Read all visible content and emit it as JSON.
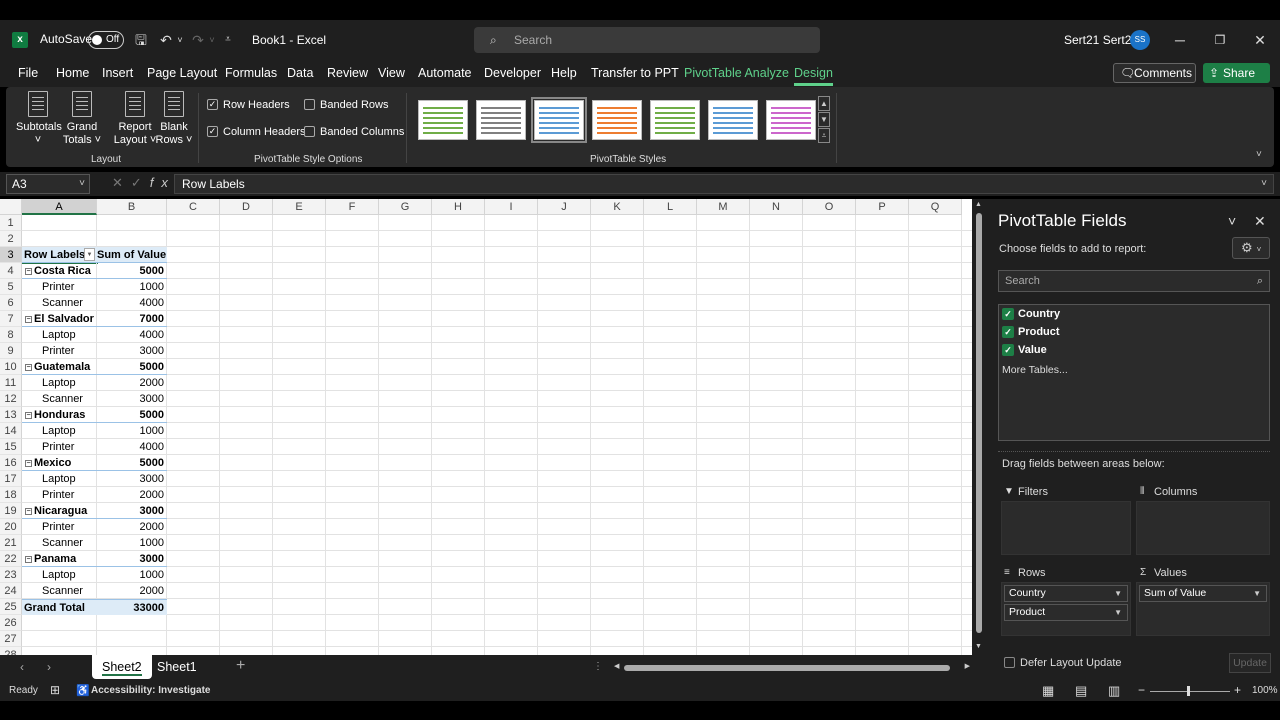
{
  "titlebar": {
    "autosave_label": "AutoSave",
    "autosave_state": "Off",
    "doc_title": "Book1 - Excel",
    "search_placeholder": "Search",
    "user_name": "Sert21 Sert21",
    "user_initials": "SS"
  },
  "menu": {
    "items": [
      "File",
      "Home",
      "Insert",
      "Page Layout",
      "Formulas",
      "Data",
      "Review",
      "View",
      "Automate",
      "Developer",
      "Help",
      "Transfer to PPT",
      "PivotTable Analyze",
      "Design"
    ],
    "comments_label": "Comments",
    "share_label": "Share"
  },
  "ribbon": {
    "layout_buttons": [
      {
        "line1": "Subtotals",
        "line2": "˅"
      },
      {
        "line1": "Grand",
        "line2": "Totals ˅"
      },
      {
        "line1": "Report",
        "line2": "Layout ˅"
      },
      {
        "line1": "Blank",
        "line2": "Rows ˅"
      }
    ],
    "layout_group": "Layout",
    "options": {
      "row_headers": "Row Headers",
      "column_headers": "Column Headers",
      "banded_rows": "Banded Rows",
      "banded_columns": "Banded Columns"
    },
    "options_group": "PivotTable Style Options",
    "styles_group": "PivotTable Styles",
    "style_colors": [
      "#70ad47",
      "#808080",
      "#5b9bd5",
      "#ed7d31",
      "#70ad47",
      "#5b9bd5",
      "#cc66cc"
    ]
  },
  "formula_bar": {
    "name_box": "A3",
    "formula": "Row Labels"
  },
  "grid": {
    "columns": [
      "A",
      "B",
      "C",
      "D",
      "E",
      "F",
      "G",
      "H",
      "I",
      "J",
      "K",
      "L",
      "M",
      "N",
      "O",
      "P",
      "Q"
    ],
    "rows": [
      "1",
      "2",
      "3",
      "4",
      "5",
      "6",
      "7",
      "8",
      "9",
      "10",
      "11",
      "12",
      "13",
      "14",
      "15",
      "16",
      "17",
      "18",
      "19",
      "20",
      "21",
      "22",
      "23",
      "24",
      "25",
      "26",
      "27",
      "28"
    ],
    "header_labels": "Row Labels",
    "header_value": "Sum of Value",
    "pivot": [
      {
        "label": "Costa Rica",
        "value": "5000",
        "type": "group"
      },
      {
        "label": "Printer",
        "value": "1000",
        "type": "item"
      },
      {
        "label": "Scanner",
        "value": "4000",
        "type": "item"
      },
      {
        "label": "El Salvador",
        "value": "7000",
        "type": "group"
      },
      {
        "label": "Laptop",
        "value": "4000",
        "type": "item"
      },
      {
        "label": "Printer",
        "value": "3000",
        "type": "item"
      },
      {
        "label": "Guatemala",
        "value": "5000",
        "type": "group"
      },
      {
        "label": "Laptop",
        "value": "2000",
        "type": "item"
      },
      {
        "label": "Scanner",
        "value": "3000",
        "type": "item"
      },
      {
        "label": "Honduras",
        "value": "5000",
        "type": "group"
      },
      {
        "label": "Laptop",
        "value": "1000",
        "type": "item"
      },
      {
        "label": "Printer",
        "value": "4000",
        "type": "item"
      },
      {
        "label": "Mexico",
        "value": "5000",
        "type": "group"
      },
      {
        "label": "Laptop",
        "value": "3000",
        "type": "item"
      },
      {
        "label": "Printer",
        "value": "2000",
        "type": "item"
      },
      {
        "label": "Nicaragua",
        "value": "3000",
        "type": "group"
      },
      {
        "label": "Printer",
        "value": "2000",
        "type": "item"
      },
      {
        "label": "Scanner",
        "value": "1000",
        "type": "item"
      },
      {
        "label": "Panama",
        "value": "3000",
        "type": "group"
      },
      {
        "label": "Laptop",
        "value": "1000",
        "type": "item"
      },
      {
        "label": "Scanner",
        "value": "2000",
        "type": "item"
      }
    ],
    "grand_total_label": "Grand Total",
    "grand_total_value": "33000"
  },
  "sheets": {
    "tabs": [
      "Sheet2",
      "Sheet1"
    ],
    "active": "Sheet2"
  },
  "status": {
    "ready": "Ready",
    "accessibility": "Accessibility: Investigate",
    "zoom": "100%"
  },
  "pane": {
    "title": "PivotTable Fields",
    "subtitle": "Choose fields to add to report:",
    "search_placeholder": "Search",
    "fields": [
      "Country",
      "Product",
      "Value"
    ],
    "more_tables": "More Tables...",
    "drag_label": "Drag fields between areas below:",
    "areas": {
      "filters": "Filters",
      "columns": "Columns",
      "rows": "Rows",
      "values": "Values"
    },
    "rows_fields": [
      "Country",
      "Product"
    ],
    "values_fields": [
      "Sum of Value"
    ],
    "defer_label": "Defer Layout Update",
    "update_label": "Update"
  }
}
